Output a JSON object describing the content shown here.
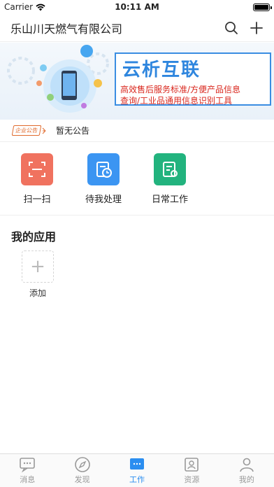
{
  "status_bar": {
    "carrier": "Carrier",
    "time": "10:11 AM",
    "battery_level": 1.0
  },
  "nav": {
    "title": "乐山川天燃气有限公司",
    "icons": [
      "search-icon",
      "plus-icon"
    ]
  },
  "banner": {
    "headline": "云析互联",
    "line1": "高效售后服务标准/方便产品信息",
    "line2": "查询/工业品通用信息识别工具"
  },
  "announcement": {
    "badge": "企业公告",
    "text": "暂无公告"
  },
  "quick_actions": [
    {
      "label": "扫一扫",
      "icon": "scan-icon",
      "color": "#f0725f"
    },
    {
      "label": "待我处理",
      "icon": "pending-tasks-icon",
      "color": "#3b95f2"
    },
    {
      "label": "日常工作",
      "icon": "daily-work-icon",
      "color": "#22b37e"
    }
  ],
  "my_apps": {
    "title": "我的应用",
    "add_label": "添加"
  },
  "tabs": [
    {
      "label": "消息",
      "icon": "message-icon",
      "active": false
    },
    {
      "label": "发现",
      "icon": "compass-icon",
      "active": false
    },
    {
      "label": "工作",
      "icon": "work-icon",
      "active": true
    },
    {
      "label": "资源",
      "icon": "resource-icon",
      "active": false
    },
    {
      "label": "我的",
      "icon": "user-icon",
      "active": false
    }
  ],
  "colors": {
    "accent": "#2b8ef0",
    "inactive_tab": "#999999",
    "banner_red": "#d9261c"
  }
}
